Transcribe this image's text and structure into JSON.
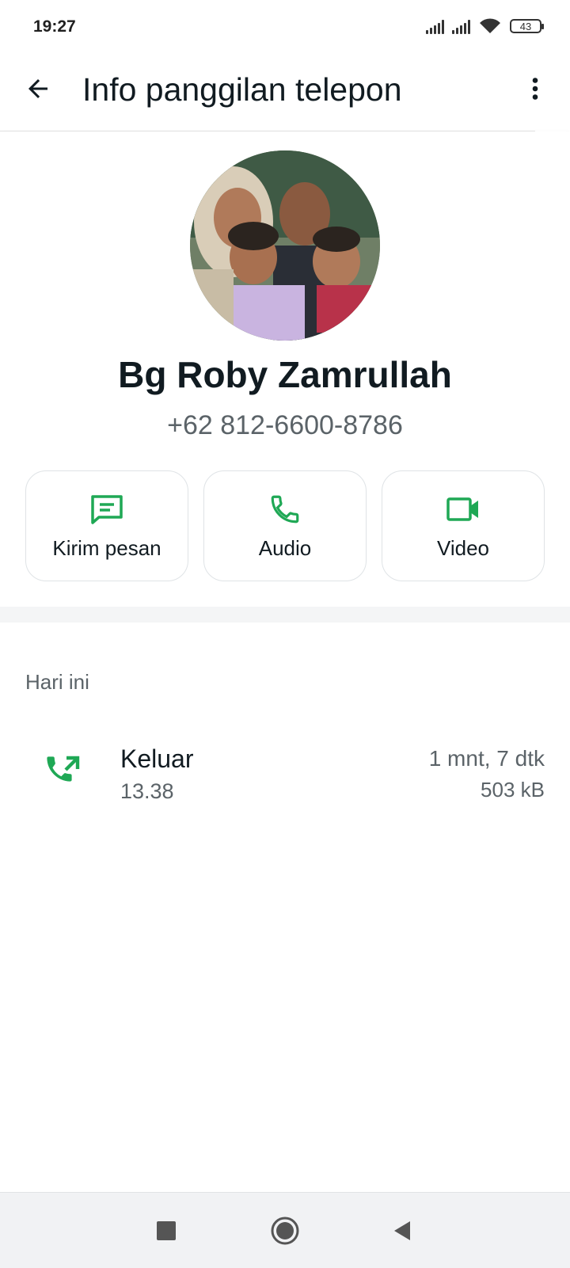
{
  "status_bar": {
    "time": "19:27",
    "battery": "43"
  },
  "header": {
    "title": "Info panggilan telepon"
  },
  "contact": {
    "name": "Bg Roby Zamrullah",
    "phone": "+62 812-6600-8786"
  },
  "actions": [
    {
      "label": "Kirim pesan",
      "icon": "message-icon"
    },
    {
      "label": "Audio",
      "icon": "phone-icon"
    },
    {
      "label": "Video",
      "icon": "video-icon"
    }
  ],
  "history": {
    "section_label": "Hari ini",
    "calls": [
      {
        "type": "Keluar",
        "time": "13.38",
        "duration": "1 mnt, 7 dtk",
        "size": "503 kB",
        "icon": "outgoing-call-icon"
      }
    ]
  },
  "colors": {
    "accent": "#1fa855",
    "text": "#111b21",
    "secondary": "#5b6368"
  }
}
